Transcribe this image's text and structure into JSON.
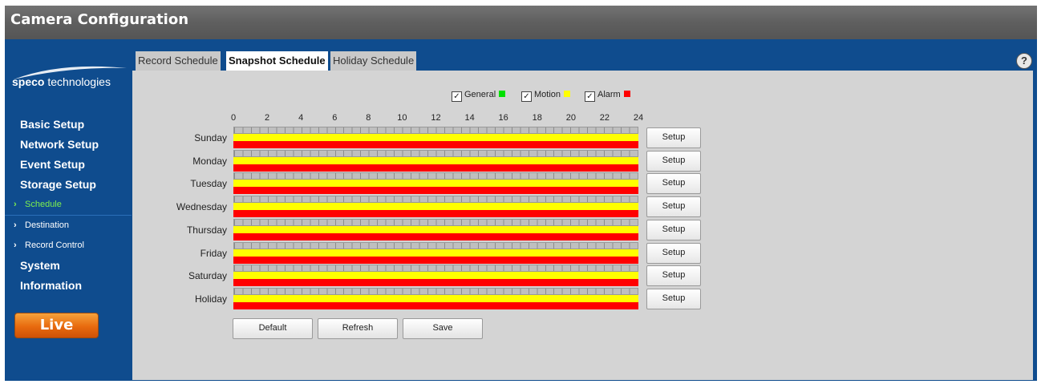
{
  "window": {
    "title": "Camera Configuration"
  },
  "brand": {
    "part1": "speco",
    "part2": " technologies"
  },
  "sidebar": {
    "items": [
      {
        "label": "Basic Setup",
        "type": "item"
      },
      {
        "label": "Network Setup",
        "type": "item"
      },
      {
        "label": "Event Setup",
        "type": "item"
      },
      {
        "label": "Storage Setup",
        "type": "item"
      },
      {
        "label": "Schedule",
        "type": "sub",
        "active": true
      },
      {
        "label": "Destination",
        "type": "sub"
      },
      {
        "label": "Record Control",
        "type": "sub"
      },
      {
        "label": "System",
        "type": "item"
      },
      {
        "label": "Information",
        "type": "item"
      }
    ],
    "live_label": "Live"
  },
  "tabs": [
    {
      "label": "Record Schedule",
      "active": false
    },
    {
      "label": "Snapshot Schedule",
      "active": true
    },
    {
      "label": "Holiday Schedule",
      "active": false
    }
  ],
  "help_label": "?",
  "legend": [
    {
      "label": "General",
      "checked": true,
      "color": "#00e000"
    },
    {
      "label": "Motion",
      "checked": true,
      "color": "#ffff00"
    },
    {
      "label": "Alarm",
      "checked": true,
      "color": "#ff0000"
    }
  ],
  "hours": [
    "0",
    "2",
    "4",
    "6",
    "8",
    "10",
    "12",
    "14",
    "16",
    "18",
    "20",
    "22",
    "24"
  ],
  "days": [
    "Sunday",
    "Monday",
    "Tuesday",
    "Wednesday",
    "Thursday",
    "Friday",
    "Saturday",
    "Holiday"
  ],
  "setup_label": "Setup",
  "actions": {
    "default": "Default",
    "refresh": "Refresh",
    "save": "Save"
  }
}
